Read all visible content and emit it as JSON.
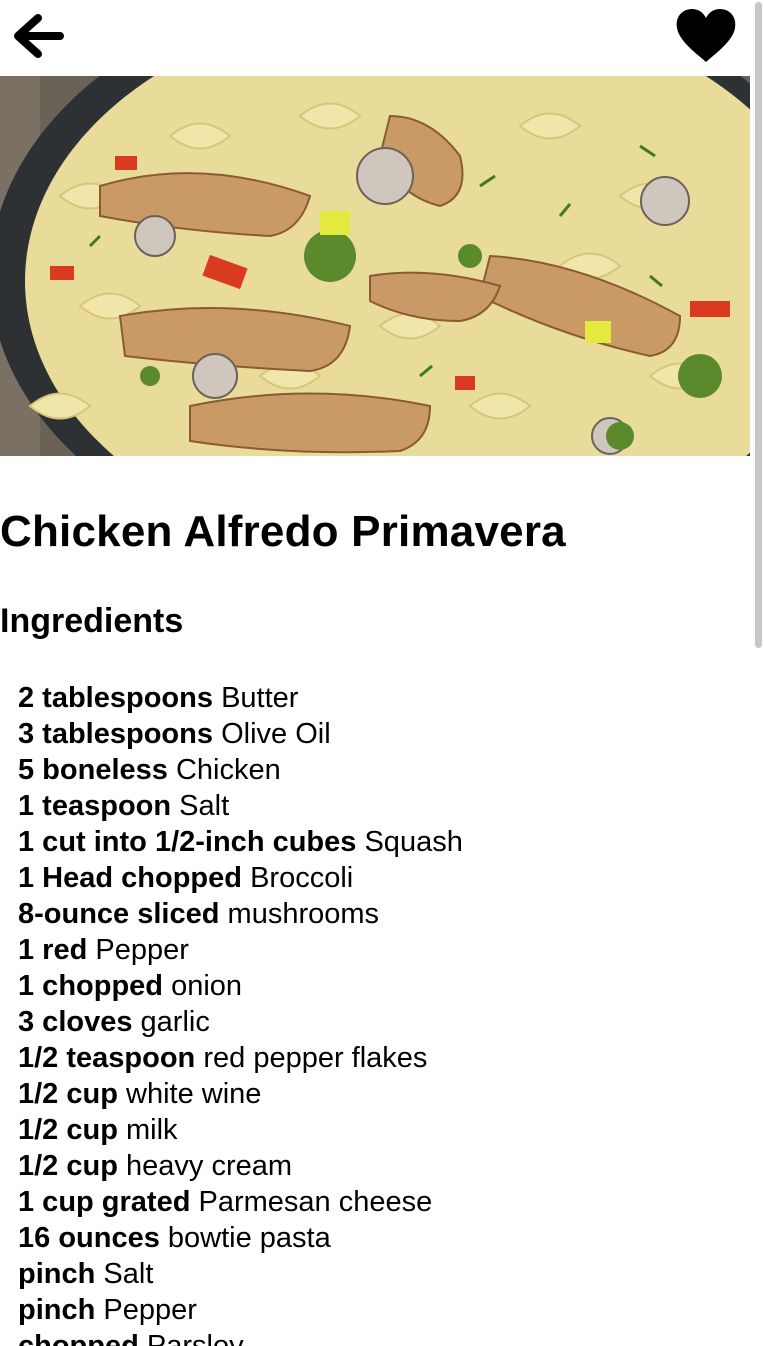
{
  "header": {
    "back_icon": "arrow-left-icon",
    "favorite_icon": "heart-icon"
  },
  "hero": {
    "image": "chicken-alfredo-pasta-photo"
  },
  "recipe": {
    "title": "Chicken Alfredo Primavera",
    "ingredients_heading": "Ingredients",
    "ingredients": [
      {
        "qty": "2 tablespoons",
        "item": "Butter"
      },
      {
        "qty": "3 tablespoons",
        "item": "Olive Oil"
      },
      {
        "qty": "5 boneless",
        "item": "Chicken"
      },
      {
        "qty": "1 teaspoon",
        "item": "Salt"
      },
      {
        "qty": "1 cut into 1/2-inch cubes",
        "item": "Squash"
      },
      {
        "qty": "1 Head chopped",
        "item": "Broccoli"
      },
      {
        "qty": "8-ounce sliced",
        "item": "mushrooms"
      },
      {
        "qty": "1 red",
        "item": "Pepper"
      },
      {
        "qty": "1 chopped",
        "item": "onion"
      },
      {
        "qty": "3 cloves",
        "item": "garlic"
      },
      {
        "qty": "1/2 teaspoon",
        "item": "red pepper flakes"
      },
      {
        "qty": "1/2 cup",
        "item": "white wine"
      },
      {
        "qty": "1/2 cup",
        "item": "milk"
      },
      {
        "qty": "1/2 cup",
        "item": "heavy cream"
      },
      {
        "qty": "1 cup grated",
        "item": "Parmesan cheese"
      },
      {
        "qty": "16 ounces",
        "item": "bowtie pasta"
      },
      {
        "qty": "pinch",
        "item": "Salt"
      },
      {
        "qty": "pinch",
        "item": "Pepper"
      },
      {
        "qty": "chopped",
        "item": "Parsley"
      }
    ]
  },
  "colors": {
    "text": "#000000",
    "background": "#ffffff",
    "scroll_thumb": "#c7c7c7"
  }
}
